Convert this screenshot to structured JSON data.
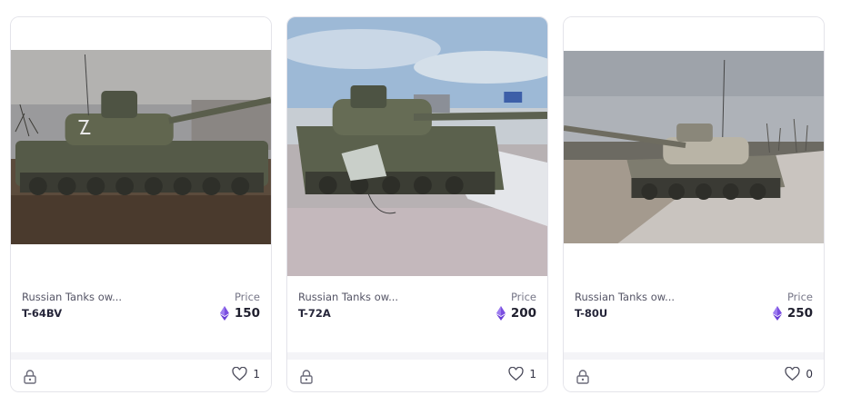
{
  "cards": [
    {
      "collection": "Russian Tanks ow...",
      "model": "T-64BV",
      "price_label": "Price",
      "price": "150",
      "likes": "1",
      "currency_icon": "ethereum-icon",
      "accent": "#7b4fe0"
    },
    {
      "collection": "Russian Tanks ow...",
      "model": "T-72A",
      "price_label": "Price",
      "price": "200",
      "likes": "1",
      "currency_icon": "ethereum-icon",
      "accent": "#7b4fe0"
    },
    {
      "collection": "Russian Tanks ow...",
      "model": "T-80U",
      "price_label": "Price",
      "price": "250",
      "likes": "0",
      "currency_icon": "ethereum-icon",
      "accent": "#7b4fe0"
    }
  ]
}
